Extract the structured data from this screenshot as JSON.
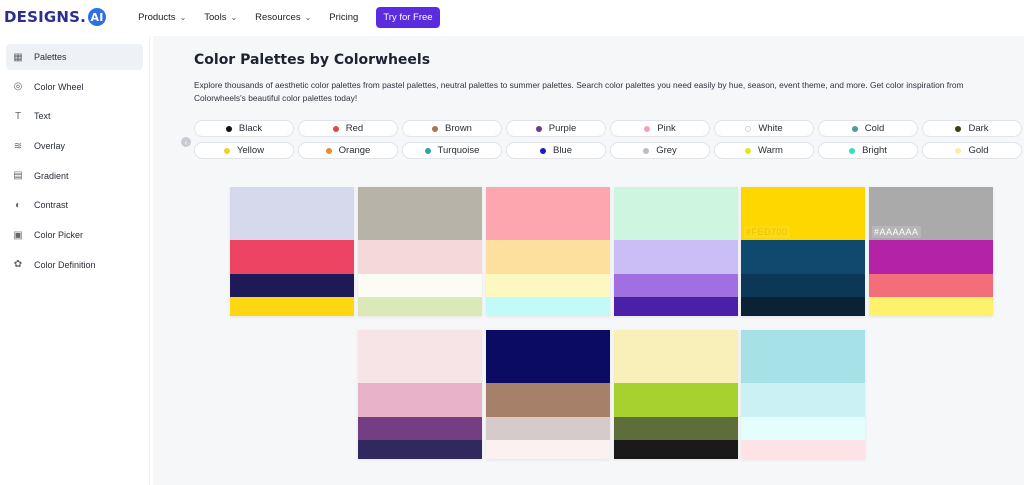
{
  "logo": {
    "text": "DESIGNS.",
    "badge": "AI"
  },
  "nav": [
    {
      "label": "Products",
      "dropdown": true
    },
    {
      "label": "Tools",
      "dropdown": true
    },
    {
      "label": "Resources",
      "dropdown": true
    },
    {
      "label": "Pricing",
      "dropdown": false
    }
  ],
  "try_button": "Try for Free",
  "sidebar": [
    {
      "label": "Palettes",
      "icon": "palettes-icon",
      "active": true
    },
    {
      "label": "Color Wheel",
      "icon": "color-wheel-icon",
      "active": false
    },
    {
      "label": "Text",
      "icon": "text-icon",
      "active": false
    },
    {
      "label": "Overlay",
      "icon": "overlay-icon",
      "active": false
    },
    {
      "label": "Gradient",
      "icon": "gradient-icon",
      "active": false
    },
    {
      "label": "Contrast",
      "icon": "contrast-icon",
      "active": false
    },
    {
      "label": "Color Picker",
      "icon": "color-picker-icon",
      "active": false
    },
    {
      "label": "Color Definition",
      "icon": "color-definition-icon",
      "active": false
    }
  ],
  "main": {
    "title": "Color Palettes by Colorwheels",
    "description": "Explore thousands of aesthetic color palettes from pastel palettes, neutral palettes to summer palettes. Search color palettes you need easily by hue, season, event theme, and more. Get color inspiration from Colorwheels's beautiful color palettes today!"
  },
  "chips": [
    {
      "label": "Black",
      "color": "#111111"
    },
    {
      "label": "Red",
      "color": "#e04848"
    },
    {
      "label": "Brown",
      "color": "#a8754a"
    },
    {
      "label": "Purple",
      "color": "#6a3b8f"
    },
    {
      "label": "Pink",
      "color": "#f4a0b8"
    },
    {
      "label": "White",
      "color": "#ffffff"
    },
    {
      "label": "Cold",
      "color": "#4f9a98"
    },
    {
      "label": "Dark",
      "color": "#3d3d12"
    },
    {
      "label": "Yellow",
      "color": "#f5d21a"
    },
    {
      "label": "Orange",
      "color": "#ee8a2a"
    },
    {
      "label": "Turquoise",
      "color": "#2aa6a6"
    },
    {
      "label": "Blue",
      "color": "#1a1acc"
    },
    {
      "label": "Grey",
      "color": "#bdbdbd"
    },
    {
      "label": "Warm",
      "color": "#ece41a"
    },
    {
      "label": "Bright",
      "color": "#2ee0c0"
    },
    {
      "label": "Gold",
      "color": "#f7f0a0"
    }
  ],
  "palettes": [
    {
      "bands": [
        {
          "color": "#d6d9ec"
        },
        {
          "color": "#ed4464"
        },
        {
          "color": "#1e1a57"
        },
        {
          "color": "#fed712"
        }
      ]
    },
    {
      "bands": [
        {
          "color": "#b7b3a8"
        },
        {
          "color": "#f5d8d9"
        },
        {
          "color": "#fcfcf5"
        },
        {
          "color": "#dbe9b8"
        }
      ]
    },
    {
      "bands": [
        {
          "color": "#fda6b0"
        },
        {
          "color": "#fee09e"
        },
        {
          "color": "#fdf8c0"
        },
        {
          "color": "#c2fafa"
        }
      ]
    },
    {
      "bands": [
        {
          "color": "#cdf5e0"
        },
        {
          "color": "#cbbdf5"
        },
        {
          "color": "#a070e0"
        },
        {
          "color": "#4c1fa8"
        }
      ]
    },
    {
      "bands": [
        {
          "color": "#fed700",
          "label": "#FED700"
        },
        {
          "color": "#0f4a6e"
        },
        {
          "color": "#0c3757"
        },
        {
          "color": "#0a2233"
        }
      ]
    },
    {
      "bands": [
        {
          "color": "#aaaaaa",
          "label": "#AAAAAA"
        },
        {
          "color": "#b422a8"
        },
        {
          "color": "#f36e78"
        },
        {
          "color": "#fef16b"
        }
      ]
    },
    {
      "bands": [
        {
          "color": "#f6e4e6"
        },
        {
          "color": "#e8b3c9"
        },
        {
          "color": "#743f82"
        },
        {
          "color": "#322860"
        }
      ]
    },
    {
      "bands": [
        {
          "color": "#0c0b64"
        },
        {
          "color": "#a68068"
        },
        {
          "color": "#d6cbca"
        },
        {
          "color": "#fbf1f1"
        }
      ]
    },
    {
      "bands": [
        {
          "color": "#f8f0b8"
        },
        {
          "color": "#a6d12e"
        },
        {
          "color": "#5d6e3a"
        },
        {
          "color": "#1a1a1a"
        }
      ]
    },
    {
      "bands": [
        {
          "color": "#a6e1e8"
        },
        {
          "color": "#ccf1f4"
        },
        {
          "color": "#e3fefd"
        },
        {
          "color": "#fde3e6"
        }
      ]
    }
  ]
}
